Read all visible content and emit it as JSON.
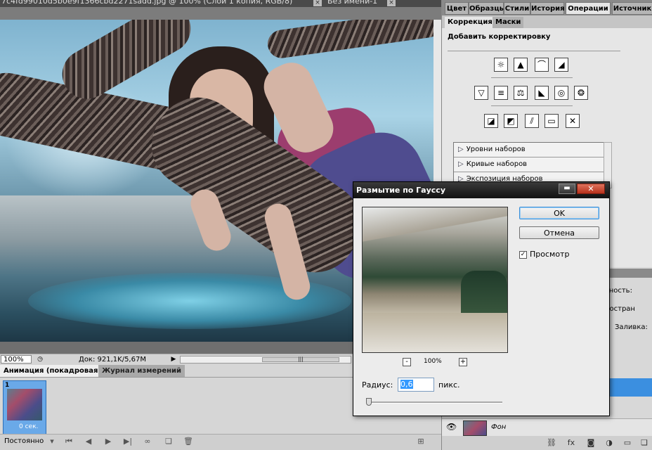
{
  "document_tabs": [
    {
      "label": "7c4fd99010d5b0e9f1366cbd2271sadd.jpg @ 100% (Слой 1 копия, RGB/8)"
    },
    {
      "label": "Без имени-1"
    }
  ],
  "statusbar": {
    "zoom": "100%",
    "doc_info": "Док: 921,1K/5,67M"
  },
  "animation_panel": {
    "tabs": [
      {
        "label": "Анимация (покадровая)"
      },
      {
        "label": "Журнал измерений"
      }
    ],
    "frame_number": "1",
    "frame_delay": "0 сек.",
    "loop": "Постоянно"
  },
  "panel_tabs": [
    {
      "label": "Цвет"
    },
    {
      "label": "Образцы"
    },
    {
      "label": "Стили"
    },
    {
      "label": "История"
    },
    {
      "label": "Операции"
    },
    {
      "label": "Источник кл"
    }
  ],
  "sub_tabs": [
    {
      "label": "Коррекция"
    },
    {
      "label": "Маски"
    }
  ],
  "adjustments": {
    "title": "Добавить корректировку",
    "presets": [
      {
        "label": "Уровни наборов"
      },
      {
        "label": "Кривые наборов"
      },
      {
        "label": "Экспозиция наборов"
      }
    ]
  },
  "layers": {
    "opacity_label": "зрачность:",
    "spread_label": "аспростран",
    "fill_label": "Заливка:",
    "background_layer": "Фон"
  },
  "dialog": {
    "title": "Размытие по Гауссу",
    "ok": "OK",
    "cancel": "Отмена",
    "preview_label": "Просмотр",
    "preview_checked": true,
    "zoom": "100%",
    "zoom_minus": "-",
    "zoom_plus": "+",
    "radius_label": "Радиус:",
    "radius_value": "0,6",
    "radius_unit": "пикс."
  }
}
